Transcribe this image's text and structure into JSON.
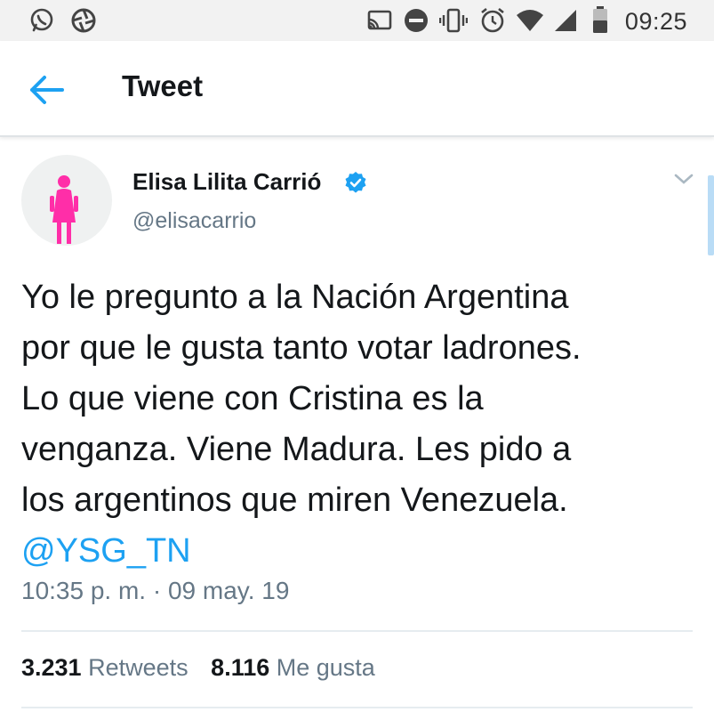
{
  "status_bar": {
    "time": "09:25",
    "left_icons": [
      "whatsapp-icon",
      "camera-aperture-icon"
    ],
    "right_icons": [
      "cast-icon",
      "do-not-disturb-icon",
      "vibrate-icon",
      "alarm-icon",
      "wifi-icon",
      "signal-icon",
      "battery-icon"
    ]
  },
  "header": {
    "title": "Tweet",
    "back_icon": "arrow-left-icon"
  },
  "tweet": {
    "author_name": "Elisa Lilita Carrió",
    "author_handle": "@elisacarrio",
    "verified": true,
    "text_lines": [
      "Yo le pregunto a la Nación Argentina",
      "por que le gusta tanto votar ladrones.",
      "Lo que viene con Cristina es la",
      "venganza. Viene Madura. Les pido a",
      "los argentinos que miren Venezuela."
    ],
    "mention": "@YSG_TN",
    "timestamp": "10:35 p. m. · 09 may. 19",
    "retweets_count": "3.231",
    "retweets_label": "Retweets",
    "likes_count": "8.116",
    "likes_label": "Me gusta"
  },
  "colors": {
    "accent": "#1da1f2",
    "secondary_text": "#657786",
    "avatar_figure": "#ff2ea8"
  }
}
